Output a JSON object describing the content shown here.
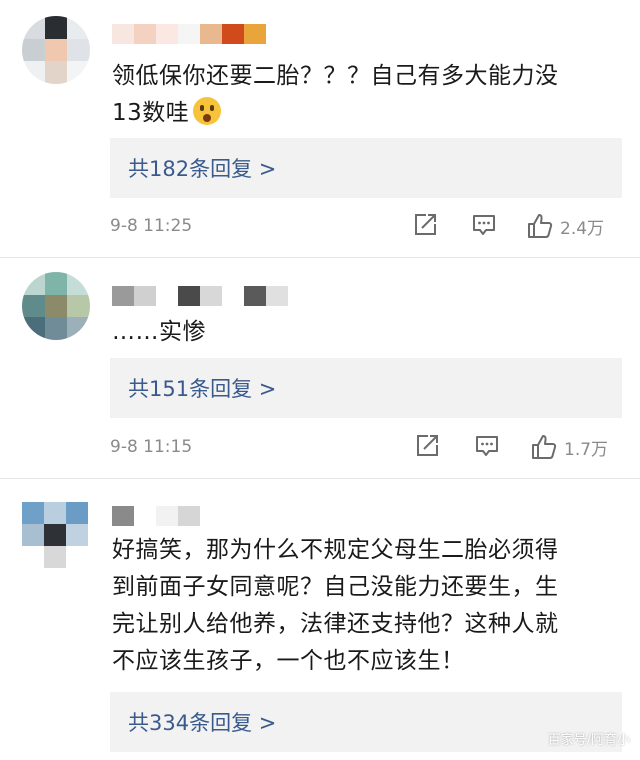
{
  "colors": {
    "reply_link": "#3a5a8c",
    "meta_gray": "#8a8a8a",
    "reply_bg": "#f2f2f2"
  },
  "comments": [
    {
      "text": "领低保你还要二胎？？？自己有多大能力没\n13数哇",
      "has_emoji": true,
      "reply_label": "共182条回复 >",
      "timestamp": "9-8 11:25",
      "likes": "2.4万"
    },
    {
      "text": "……实惨",
      "has_emoji": false,
      "reply_label": "共151条回复 >",
      "timestamp": "9-8 11:15",
      "likes": "1.7万"
    },
    {
      "text": "好搞笑，那为什么不规定父母生二胎必须得\n到前面子女同意呢？自己没能力还要生，生\n完让别人给他养，法律还支持他？这种人就\n不应该生孩子，一个也不应该生！",
      "has_emoji": false,
      "reply_label": "共334条回复 >",
      "timestamp": "",
      "likes": ""
    }
  ],
  "watermark": "百家号/阿育小"
}
